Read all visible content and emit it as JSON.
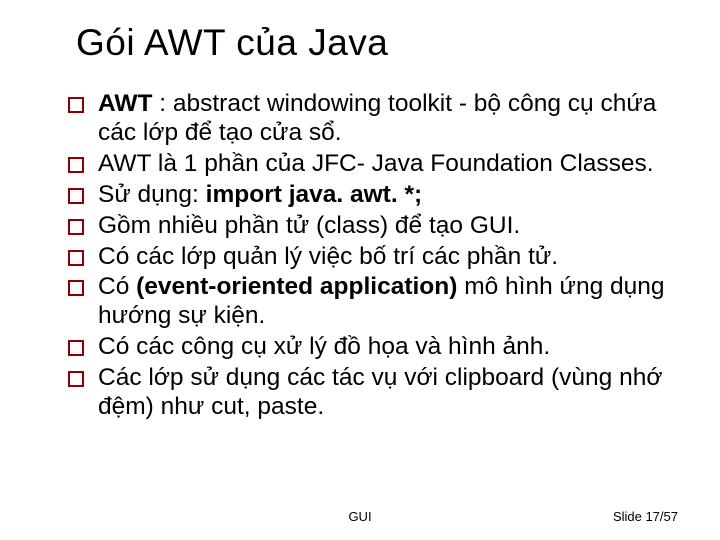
{
  "title": "Gói AWT của Java",
  "items": [
    {
      "pre": "",
      "b1": "AWT",
      "mid": " : abstract windowing toolkit - bộ công cụ chứa các lớp để tạo cửa sổ.",
      "b2": "",
      "post": ""
    },
    {
      "pre": "AWT là 1 phần của JFC- Java Foundation Classes.",
      "b1": "",
      "mid": "",
      "b2": "",
      "post": ""
    },
    {
      "pre": "Sử dụng:   ",
      "b1": "import java. awt. *;",
      "mid": "",
      "b2": "",
      "post": ""
    },
    {
      "pre": "Gồm nhiều phần tử (class) để tạo GUI.",
      "b1": "",
      "mid": "",
      "b2": "",
      "post": ""
    },
    {
      "pre": "Có các lớp quản lý việc bố trí các phần tử.",
      "b1": "",
      "mid": "",
      "b2": "",
      "post": ""
    },
    {
      "pre": "Có ",
      "b1": "(event-oriented application)",
      "mid": " mô hình ứng dụng hướng sự kiện.",
      "b2": "",
      "post": ""
    },
    {
      "pre": "Có các công cụ xử lý đồ họa và hình ảnh.",
      "b1": "",
      "mid": "",
      "b2": "",
      "post": ""
    },
    {
      "pre": "Các lớp sử dụng các tác vụ với clipboard (vùng nhớ đệm) như cut, paste.",
      "b1": "",
      "mid": "",
      "b2": "",
      "post": ""
    }
  ],
  "footer_center": "GUI",
  "footer_right": "Slide 17/57"
}
